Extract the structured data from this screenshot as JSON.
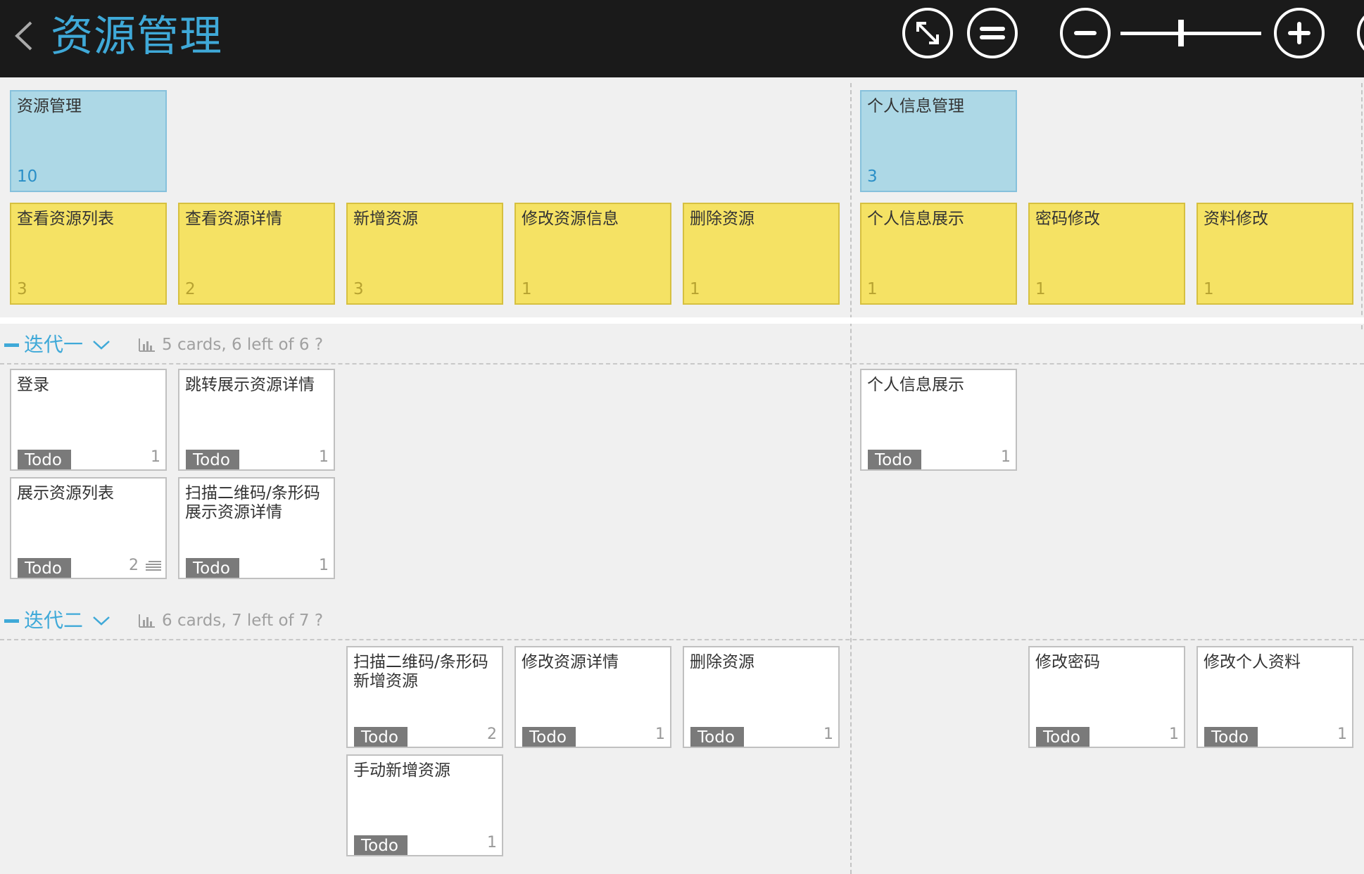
{
  "header": {
    "title": "资源管理",
    "icons": [
      "chevron-left-icon",
      "fullscreen-icon",
      "menu-icon",
      "zoom-out-icon",
      "zoom-slider",
      "zoom-in-icon"
    ]
  },
  "epics": [
    {
      "label": "资源管理",
      "count": "10"
    },
    {
      "label": "个人信息管理",
      "count": "3"
    }
  ],
  "features": [
    {
      "label": "查看资源列表",
      "count": "3"
    },
    {
      "label": "查看资源详情",
      "count": "2"
    },
    {
      "label": "新增资源",
      "count": "3"
    },
    {
      "label": "修改资源信息",
      "count": "1"
    },
    {
      "label": "删除资源",
      "count": "1"
    },
    {
      "label": "个人信息展示",
      "count": "1"
    },
    {
      "label": "密码修改",
      "count": "1"
    },
    {
      "label": "资料修改",
      "count": "1"
    }
  ],
  "iterations": [
    {
      "name": "迭代一",
      "stats": "5 cards, 6 left of 6 ?"
    },
    {
      "name": "迭代二",
      "stats": "6 cards, 7 left of 7 ?"
    }
  ],
  "stories": [
    {
      "label": "登录",
      "status": "Todo",
      "points": "1"
    },
    {
      "label": "跳转展示资源详情",
      "status": "Todo",
      "points": "1"
    },
    {
      "label": "个人信息展示",
      "status": "Todo",
      "points": "1"
    },
    {
      "label": "展示资源列表",
      "status": "Todo",
      "points": "2"
    },
    {
      "label": "扫描二维码/条形码展示资源详情",
      "status": "Todo",
      "points": "1"
    },
    {
      "label": "扫描二维码/条形码新增资源",
      "status": "Todo",
      "points": "2"
    },
    {
      "label": "修改资源详情",
      "status": "Todo",
      "points": "1"
    },
    {
      "label": "删除资源",
      "status": "Todo",
      "points": "1"
    },
    {
      "label": "修改密码",
      "status": "Todo",
      "points": "1"
    },
    {
      "label": "修改个人资料",
      "status": "Todo",
      "points": "1"
    },
    {
      "label": "手动新增资源",
      "status": "Todo",
      "points": "1"
    }
  ],
  "colors": {
    "accent": "#3fa9d8",
    "epic": "#add8e6",
    "feature": "#f5e264",
    "topbar": "#1a1a1a"
  }
}
